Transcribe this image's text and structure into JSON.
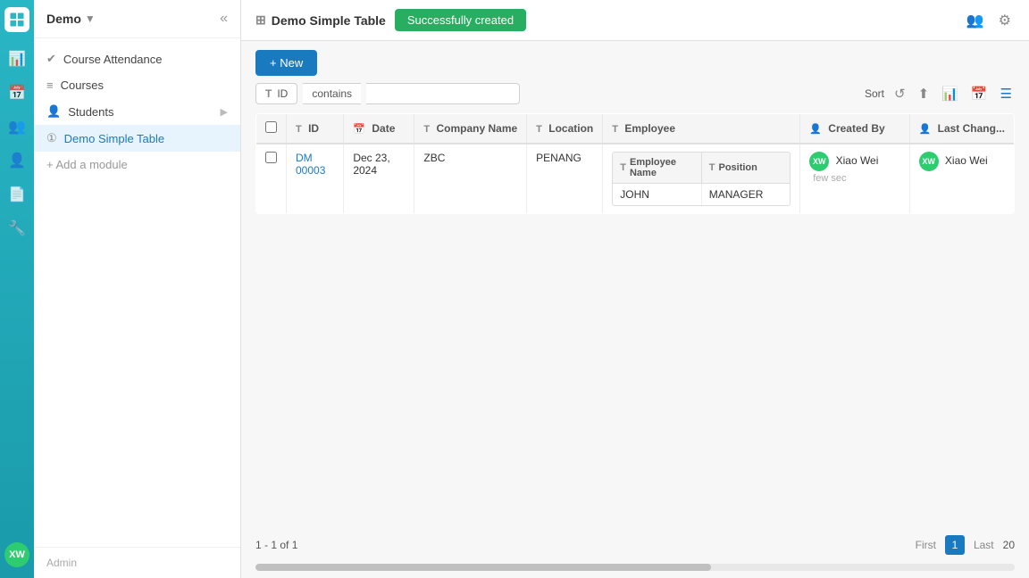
{
  "app": {
    "logo_initials": "XW",
    "rail_icons": [
      "bar-chart",
      "calendar",
      "users",
      "user-plus",
      "file",
      "wrench"
    ]
  },
  "sidebar": {
    "title": "Demo",
    "nav_items": [
      {
        "id": "course-attendance",
        "label": "Course Attendance",
        "icon": "✔",
        "active": false
      },
      {
        "id": "courses",
        "label": "Courses",
        "icon": "≡",
        "active": false
      },
      {
        "id": "students",
        "label": "Students",
        "icon": "👤",
        "active": false,
        "has_arrow": true
      },
      {
        "id": "demo-simple-table",
        "label": "Demo Simple Table",
        "icon": "①",
        "active": true
      }
    ],
    "add_module_label": "+ Add a module",
    "footer_label": "Admin"
  },
  "topbar": {
    "page_icon": "⊞",
    "page_title": "Demo Simple Table",
    "success_message": "Successfully created",
    "icons": [
      "people",
      "gear"
    ]
  },
  "toolbar": {
    "new_button_label": "+ New"
  },
  "filter": {
    "field_icon": "T",
    "field_label": "ID",
    "operator_label": "contains",
    "value": "",
    "sort_label": "Sort"
  },
  "table": {
    "columns": [
      {
        "id": "id",
        "label": "ID",
        "icon": "T"
      },
      {
        "id": "date",
        "label": "Date",
        "icon": "📅"
      },
      {
        "id": "company_name",
        "label": "Company Name",
        "icon": "T"
      },
      {
        "id": "location",
        "label": "Location",
        "icon": "T"
      },
      {
        "id": "employee",
        "label": "Employee",
        "icon": "T"
      },
      {
        "id": "created_by",
        "label": "Created By",
        "icon": "👤"
      },
      {
        "id": "last_changed",
        "label": "Last Chang...",
        "icon": "👤"
      }
    ],
    "employee_sub_columns": [
      {
        "label": "Employee Name",
        "icon": "T"
      },
      {
        "label": "Position",
        "icon": "T"
      }
    ],
    "rows": [
      {
        "id": "DM 00003",
        "date": "Dec 23, 2024",
        "company_name": "ZBC",
        "location": "PENANG",
        "employee_name": "JOHN",
        "employee_position": "MANAGER",
        "created_by": "Xiao Wei",
        "created_by_time": "few sec",
        "last_changed_by": "Xiao Wei"
      }
    ]
  },
  "pagination": {
    "summary": "1 - 1 of 1",
    "first_label": "First",
    "current_page": "1",
    "last_label": "Last",
    "page_size": "20"
  }
}
